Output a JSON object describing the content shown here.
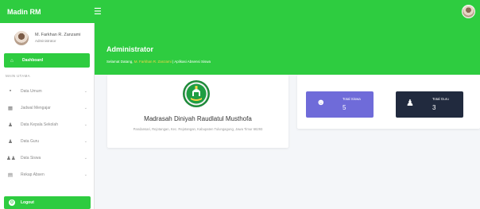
{
  "topbar": {
    "brand": "Madin RM",
    "menu_icon": "hamburger-icon"
  },
  "sidebar": {
    "user_name": "M. Farkhan R. Zanzami",
    "user_role": "Administrator",
    "dashboard": {
      "label": "Dashboard",
      "icon": "home-icon"
    },
    "section_header": "MAIN UTAMA",
    "items": [
      {
        "label": "Data Umum",
        "icon": "folder-icon"
      },
      {
        "label": "Jadwal Mengajar",
        "icon": "calendar-icon"
      },
      {
        "label": "Data Kepala Sekolah",
        "icon": "user-icon"
      },
      {
        "label": "Data Guru",
        "icon": "user-icon"
      },
      {
        "label": "Data Siswa",
        "icon": "users-icon"
      },
      {
        "label": "Rekap Absen",
        "icon": "table-icon"
      }
    ],
    "logout": "Logout"
  },
  "hero": {
    "title": "Administrator",
    "subtitle_before": "Selamat Datang, ",
    "subtitle_name": "M. Farkhan R. Zanzami",
    "subtitle_after": " | Aplikasi Absensi Siswa"
  },
  "school": {
    "name": "Madrasah Diniyah Raudlatul Musthofa",
    "address": "Pandansari, Rejotangan, Kec. Rejotangan, Kabupaten Tulungagung, Jawa Timur 66293"
  },
  "stats": {
    "siswa": {
      "label": "Total Siswa",
      "value": "5"
    },
    "guru": {
      "label": "Total Guru",
      "value": "3"
    }
  },
  "colors": {
    "primary": "#2ecc40",
    "siswa": "#6f6bd9",
    "guru": "#212a3e",
    "highlight": "#f5d547"
  }
}
